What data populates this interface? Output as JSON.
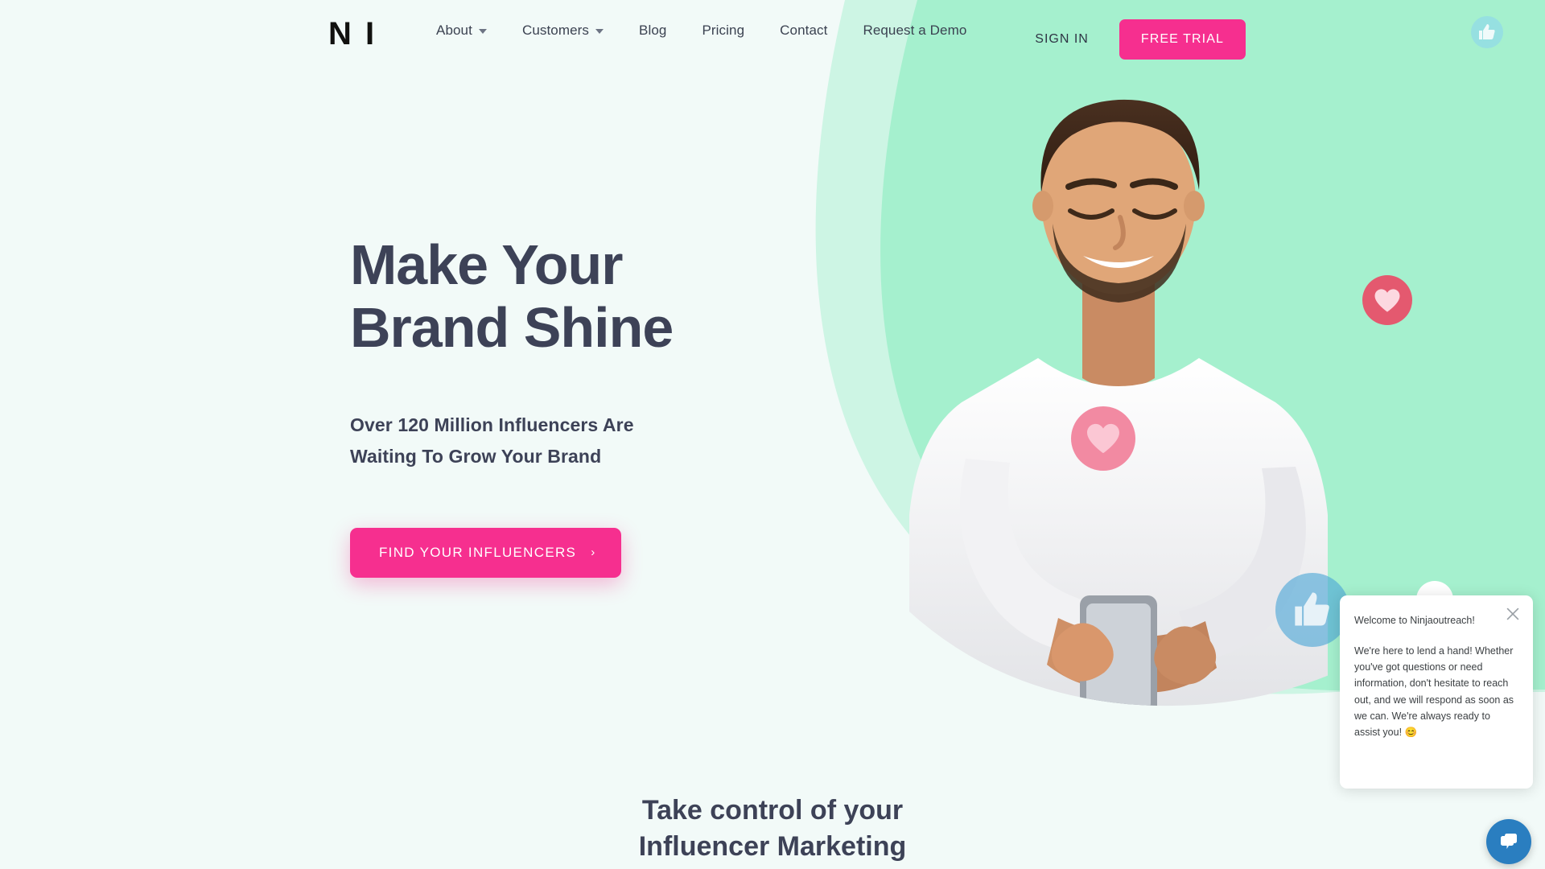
{
  "brand": {
    "logo_text": "N I",
    "name": "Ninjaoutreach"
  },
  "colors": {
    "accent_pink": "#f62f8f",
    "mint_blob": "#a5f0ce",
    "mint_blob_light": "#cdf5e4",
    "page_bg": "#f2faf8",
    "heading": "#3d4257",
    "chat_blue": "#2a7ec0"
  },
  "nav": {
    "items": [
      {
        "label": "About",
        "has_dropdown": true
      },
      {
        "label": "Customers",
        "has_dropdown": true
      },
      {
        "label": "Blog",
        "has_dropdown": false
      },
      {
        "label": "Pricing",
        "has_dropdown": false
      },
      {
        "label": "Contact",
        "has_dropdown": false
      },
      {
        "label": "Request a Demo",
        "has_dropdown": false
      }
    ],
    "sign_in": "SIGN IN",
    "free_trial": "FREE TRIAL",
    "thumb_icon": "thumbs-up-icon"
  },
  "hero": {
    "title_line_1": "Make Your",
    "title_line_2": "Brand Shine",
    "sub_line_1": "Over 120 Million Influencers Are",
    "sub_line_2": "Waiting To Grow Your Brand",
    "cta_label": "FIND YOUR INFLUENCERS",
    "cta_chevron": "›",
    "badges": [
      {
        "icon": "heart-icon",
        "color": "#f28aa2"
      },
      {
        "icon": "heart-icon",
        "color": "#e4596f"
      },
      {
        "icon": "thumbs-up-icon",
        "color": "#4ca7d6"
      }
    ],
    "photo_alt": "smiling-man-holding-phone"
  },
  "chat": {
    "logo_mark": "NinjaOutreach",
    "close_icon": "close-icon",
    "greeting": "Welcome to Ninjaoutreach!",
    "message": "We're here to lend a hand! Whether you've got questions or need information, don't hesitate to reach out, and we will respond as soon as we can. We're always ready to assist you! 😊",
    "launcher_icon": "chat-bubbles-icon"
  },
  "section_2": {
    "heading_line_1": "Take control of your",
    "heading_line_2": "Influencer Marketing"
  }
}
